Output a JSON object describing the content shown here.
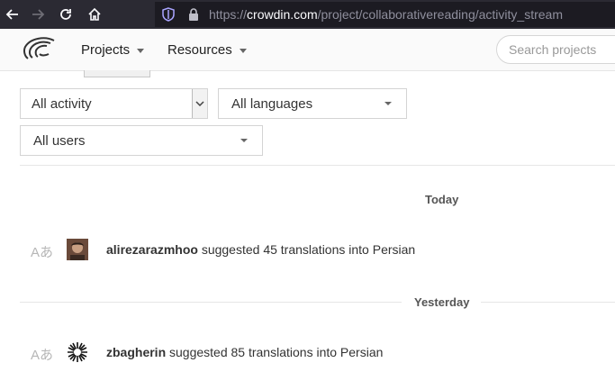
{
  "browser": {
    "url_prefix": "https://",
    "url_domain": "crowdin.com",
    "url_path": "/project/collaborativereading/activity_stream"
  },
  "header": {
    "nav": [
      {
        "label": "Projects"
      },
      {
        "label": "Resources"
      }
    ],
    "search": {
      "placeholder": "Search projects"
    }
  },
  "filters": {
    "activity": {
      "value": "All activity"
    },
    "languages": {
      "value": "All languages"
    },
    "users": {
      "value": "All users"
    }
  },
  "stream": {
    "groups": [
      {
        "day": "Today",
        "items": [
          {
            "user": "alirezarazmhoo",
            "text": " suggested 45 translations into Persian"
          }
        ]
      },
      {
        "day": "Yesterday",
        "items": [
          {
            "user": "zbagherin",
            "text": " suggested 85 translations into Persian"
          }
        ]
      }
    ]
  },
  "icons": {
    "translation": "Aあ"
  },
  "colors": {
    "browser_bg": "#2b2a33",
    "url_bg": "#1c1b22",
    "header_bg": "#fafafa"
  }
}
